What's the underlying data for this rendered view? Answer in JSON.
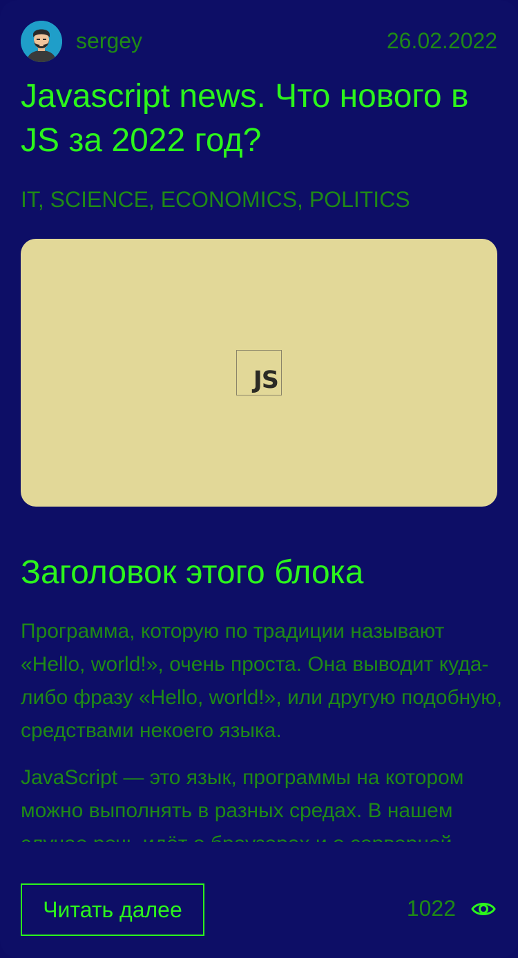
{
  "post": {
    "author": "sergey",
    "date": "26.02.2022",
    "title": "Javascript news. Что нового в JS за 2022 год?",
    "tags": "IT, SCIENCE, ECONOMICS, POLITICS",
    "image_logo_text": "JS",
    "section_title": "Заголовок этого блока",
    "paragraphs": [
      "Программа, которую по традиции называют «Hello, world!», очень проста. Она выводит куда-либо фразу «Hello, world!», или другую подобную, средствами некоего языка.",
      "JavaScript — это язык, программы на котором можно выполнять в разных средах. В нашем случае речь идёт о браузерах и о серверной"
    ],
    "read_more_label": "Читать далее",
    "views": "1022"
  },
  "icons": {
    "avatar": "bearded-man-avatar",
    "views": "eye-icon"
  },
  "colors": {
    "background": "#0d0e66",
    "accent": "#2cf51c",
    "muted_text": "#1f8a16",
    "image_bg": "#e2d898"
  }
}
